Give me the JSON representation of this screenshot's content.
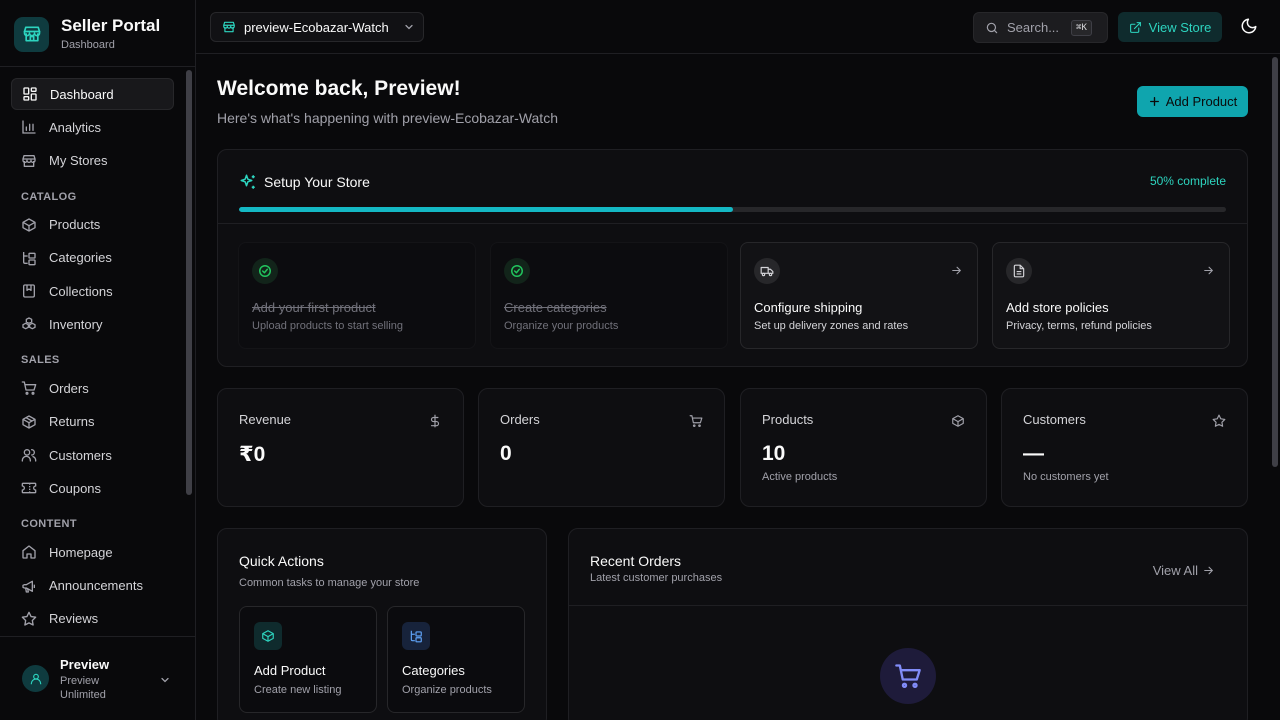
{
  "brand": {
    "title": "Seller Portal",
    "subtitle": "Dashboard"
  },
  "sidebar": {
    "main_items": [
      {
        "label": "Dashboard",
        "icon": "dashboard-icon",
        "active": true
      },
      {
        "label": "Analytics",
        "icon": "bar-chart-icon"
      },
      {
        "label": "My Stores",
        "icon": "store-icon"
      }
    ],
    "sections": [
      {
        "title": "CATALOG",
        "items": [
          {
            "label": "Products",
            "icon": "package-icon"
          },
          {
            "label": "Categories",
            "icon": "folder-tree-icon"
          },
          {
            "label": "Collections",
            "icon": "book-icon"
          },
          {
            "label": "Inventory",
            "icon": "boxes-icon"
          }
        ]
      },
      {
        "title": "SALES",
        "items": [
          {
            "label": "Orders",
            "icon": "cart-icon"
          },
          {
            "label": "Returns",
            "icon": "return-package-icon"
          },
          {
            "label": "Customers",
            "icon": "users-icon"
          },
          {
            "label": "Coupons",
            "icon": "ticket-icon"
          }
        ]
      },
      {
        "title": "CONTENT",
        "items": [
          {
            "label": "Homepage",
            "icon": "home-icon"
          },
          {
            "label": "Announcements",
            "icon": "megaphone-icon"
          },
          {
            "label": "Reviews",
            "icon": "star-icon"
          }
        ]
      }
    ]
  },
  "user": {
    "name": "Preview",
    "plan": "Preview Unlimited"
  },
  "topbar": {
    "store_name": "preview-Ecobazar-Watch",
    "search_placeholder": "Search...",
    "search_shortcut": "⌘K",
    "view_store_label": "View Store"
  },
  "main": {
    "welcome": "Welcome back, Preview!",
    "welcome_sub": "Here's what's happening with preview-Ecobazar-Watch",
    "add_product_label": "Add Product"
  },
  "setup": {
    "title": "Setup Your Store",
    "percent_label": "50% complete",
    "progress": 0.5,
    "steps": [
      {
        "title": "Add your first product",
        "desc": "Upload products to start selling",
        "done": true
      },
      {
        "title": "Create categories",
        "desc": "Organize your products",
        "done": true
      },
      {
        "title": "Configure shipping",
        "desc": "Set up delivery zones and rates",
        "done": false
      },
      {
        "title": "Add store policies",
        "desc": "Privacy, terms, refund policies",
        "done": false
      }
    ]
  },
  "stats": [
    {
      "label": "Revenue",
      "value": "₹0",
      "sub": "",
      "icon": "dollar-icon"
    },
    {
      "label": "Orders",
      "value": "0",
      "sub": "",
      "icon": "cart-icon"
    },
    {
      "label": "Products",
      "value": "10",
      "sub": "Active products",
      "icon": "package-icon"
    },
    {
      "label": "Customers",
      "value": "—",
      "sub": "No customers yet",
      "icon": "star-icon"
    }
  ],
  "quick_actions": {
    "title": "Quick Actions",
    "subtitle": "Common tasks to manage your store",
    "items": [
      {
        "title": "Add Product",
        "desc": "Create new listing",
        "icon": "package-icon",
        "color": "#2dd4bf"
      },
      {
        "title": "Categories",
        "desc": "Organize products",
        "icon": "folder-tree-icon",
        "color": "#60a5fa"
      }
    ]
  },
  "recent_orders": {
    "title": "Recent Orders",
    "subtitle": "Latest customer purchases",
    "view_all_label": "View All"
  }
}
